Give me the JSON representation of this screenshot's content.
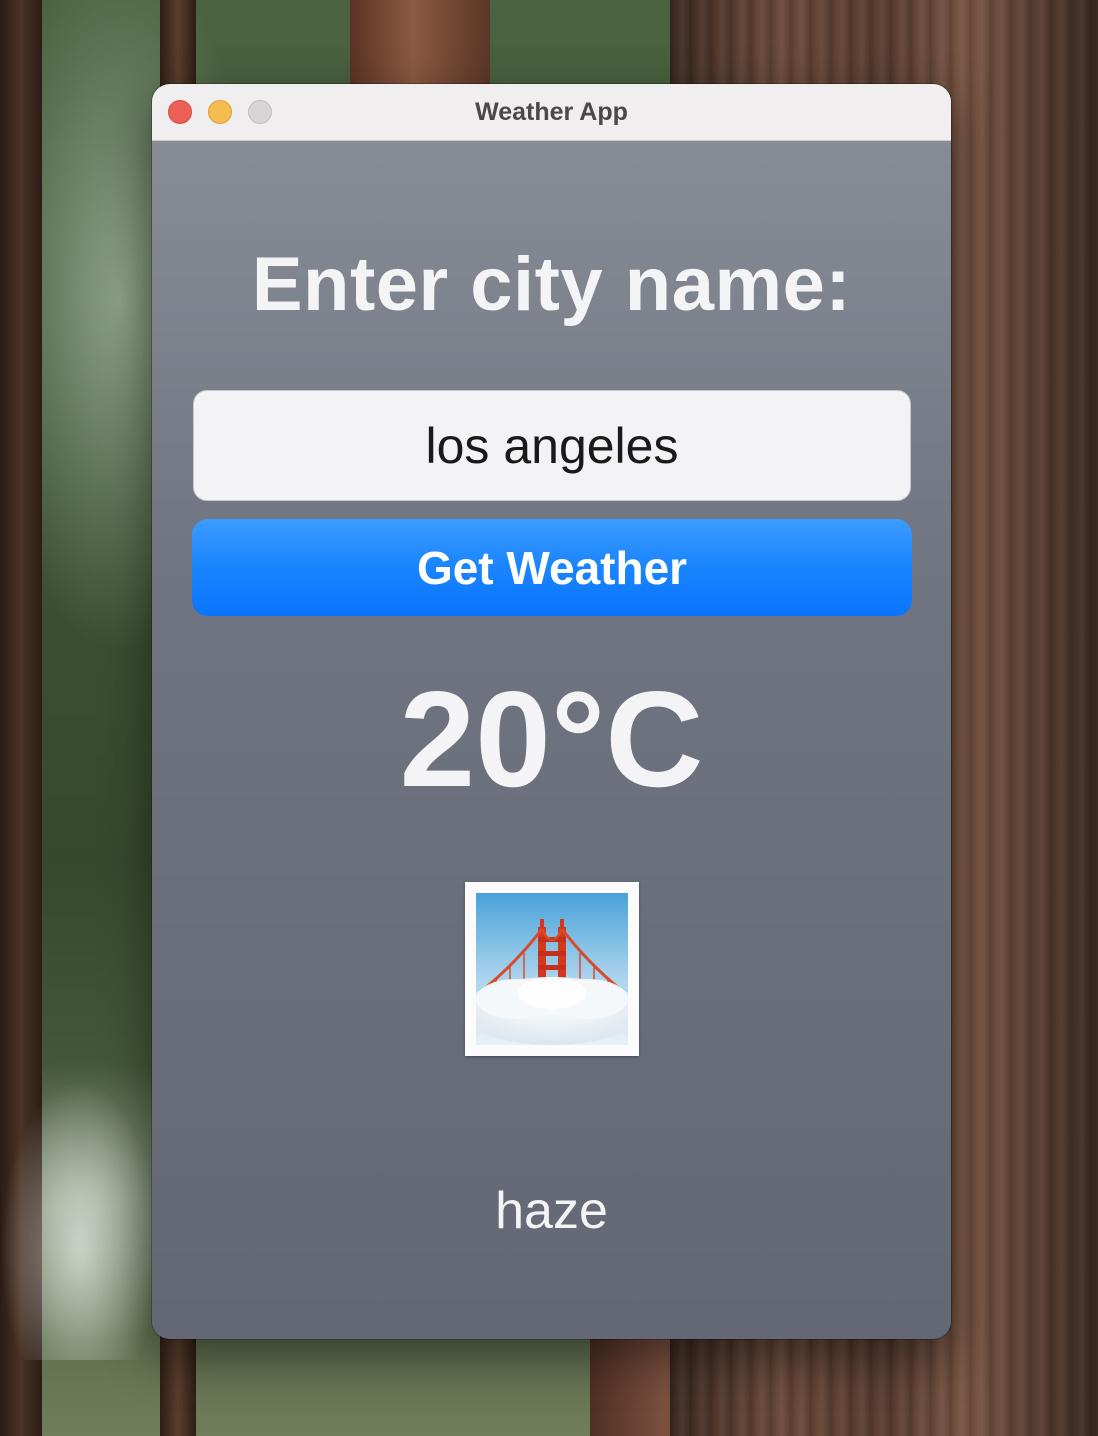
{
  "window": {
    "title": "Weather App"
  },
  "form": {
    "prompt_label": "Enter city name:",
    "city_input_value": "los angeles",
    "get_weather_label": "Get Weather"
  },
  "result": {
    "temperature": "20°C",
    "condition_icon": "fog-bridge-icon",
    "description": "haze"
  },
  "colors": {
    "button_accent": "#1a84ff",
    "window_body": "#6f7480",
    "close_button": "#ee5f57",
    "minimize_button": "#f5bd4f",
    "zoom_button": "#d6d4d4"
  }
}
